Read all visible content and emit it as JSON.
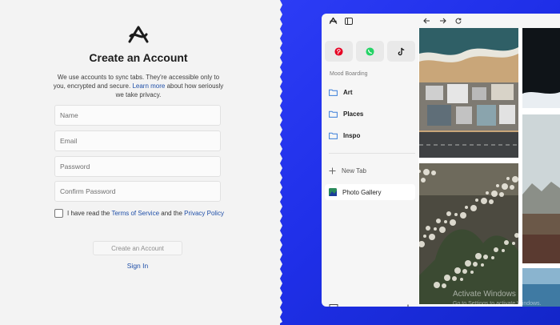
{
  "signup": {
    "logo": "arc-logo-icon",
    "title": "Create an Account",
    "description_before_link": "We use accounts to sync tabs. They're accessible only to you, encrypted and secure. ",
    "description_link": "Learn more",
    "description_after_link": " about how seriously we take privacy.",
    "fields": {
      "name_placeholder": "Name",
      "email_placeholder": "Email",
      "password_placeholder": "Password",
      "confirm_placeholder": "Confirm Password"
    },
    "terms": {
      "prefix": "I have read the ",
      "tos_link": "Terms of Service",
      "middle": " and the ",
      "privacy_link": "Privacy Policy",
      "checked": false
    },
    "create_button": "Create an Account",
    "signin_link": "Sign In"
  },
  "browser": {
    "toolbar_icons": [
      "arc-logo-icon",
      "sidebar-toggle-icon",
      "back-arrow-icon",
      "forward-arrow-icon",
      "reload-icon"
    ],
    "favorites": [
      {
        "icon": "pinterest-icon",
        "color": "#e60023"
      },
      {
        "icon": "whatsapp-icon",
        "color": "#25d366"
      },
      {
        "icon": "tiktok-icon",
        "color": "#111111"
      }
    ],
    "space_title": "Mood Boarding",
    "folders": [
      "Art",
      "Places",
      "Inspo"
    ],
    "new_tab_label": "New Tab",
    "active_tab_label": "Photo Gallery",
    "bottom_icons": [
      "archive-icon",
      "plus-icon"
    ]
  },
  "watermark": {
    "line1": "Activate Windows",
    "line2": "Go to Settings to activate Windows."
  },
  "colors": {
    "accent_blue": "#2c3cf5",
    "link": "#1f4fa8",
    "folder_icon": "#3b7fd9"
  }
}
